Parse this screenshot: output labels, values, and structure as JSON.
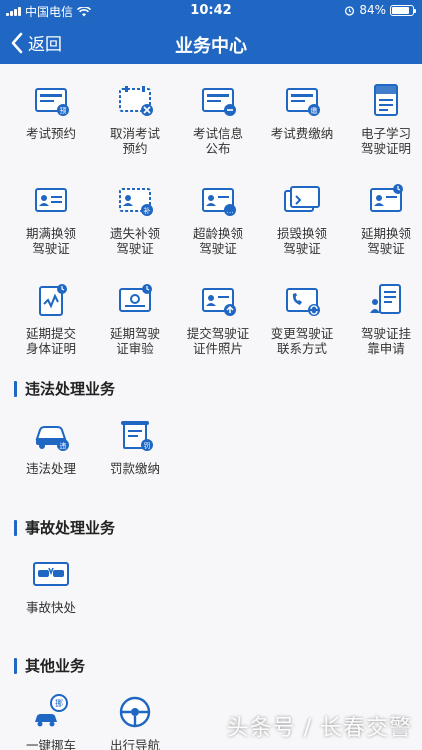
{
  "status": {
    "carrier": "中国电信",
    "time": "10:42",
    "battery_text": "84%",
    "battery_level": 0.84
  },
  "nav": {
    "back_label": "返回",
    "title": "业务中心"
  },
  "colors": {
    "primary": "#1f67c2",
    "accent": "#1f67c2"
  },
  "services_top": [
    {
      "label": "考试预约",
      "icon": "exam-appointment-icon"
    },
    {
      "label": "取消考试\n预约",
      "icon": "cancel-exam-icon"
    },
    {
      "label": "考试信息\n公布",
      "icon": "exam-info-icon"
    },
    {
      "label": "考试费缴纳",
      "icon": "exam-fee-icon"
    },
    {
      "label": "电子学习\n驾驶证明",
      "icon": "e-learning-icon"
    },
    {
      "label": "期满换领\n驾驶证",
      "icon": "expire-renew-icon"
    },
    {
      "label": "遗失补领\n驾驶证",
      "icon": "lost-replace-icon"
    },
    {
      "label": "超龄换领\n驾驶证",
      "icon": "overage-renew-icon"
    },
    {
      "label": "损毁换领\n驾驶证",
      "icon": "damaged-renew-icon"
    },
    {
      "label": "延期换领\n驾驶证",
      "icon": "delay-renew-icon"
    },
    {
      "label": "延期提交\n身体证明",
      "icon": "health-proof-icon"
    },
    {
      "label": "延期驾驶\n证审验",
      "icon": "delay-verify-icon"
    },
    {
      "label": "提交驾驶证\n证件照片",
      "icon": "photo-submit-icon"
    },
    {
      "label": "变更驾驶证\n联系方式",
      "icon": "contact-change-icon"
    },
    {
      "label": "驾驶证挂\n靠申请",
      "icon": "affiliation-icon"
    }
  ],
  "sections": [
    {
      "title": "违法处理业务",
      "items": [
        {
          "label": "违法处理",
          "icon": "violation-icon"
        },
        {
          "label": "罚款缴纳",
          "icon": "fine-payment-icon"
        }
      ]
    },
    {
      "title": "事故处理业务",
      "items": [
        {
          "label": "事故快处",
          "icon": "accident-icon"
        }
      ]
    },
    {
      "title": "其他业务",
      "items": [
        {
          "label": "一键挪车",
          "icon": "move-car-icon"
        },
        {
          "label": "出行导航",
          "icon": "navigation-icon"
        }
      ]
    }
  ],
  "watermark": "头条号 / 长春交警"
}
